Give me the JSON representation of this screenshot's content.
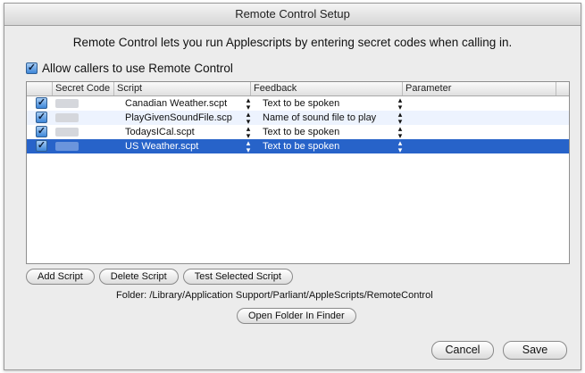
{
  "window": {
    "title": "Remote Control Setup"
  },
  "intro_text": "Remote Control lets you run Applescripts by entering secret codes when calling in.",
  "allow_checkbox": {
    "label": "Allow callers to use Remote Control",
    "checked": true
  },
  "table": {
    "columns": [
      "Secret Code",
      "Script",
      "Feedback",
      "Parameter"
    ],
    "rows": [
      {
        "enabled": true,
        "script": "Canadian Weather.scpt",
        "feedback": "Text to be spoken",
        "parameter": "",
        "selected": false
      },
      {
        "enabled": true,
        "script": "PlayGivenSoundFile.scp",
        "feedback": "Name of sound file to play",
        "parameter": "",
        "selected": false
      },
      {
        "enabled": true,
        "script": "TodaysICal.scpt",
        "feedback": "Text to be spoken",
        "parameter": "",
        "selected": false
      },
      {
        "enabled": true,
        "script": "US Weather.scpt",
        "feedback": "Text to be spoken",
        "parameter": "",
        "selected": true
      }
    ]
  },
  "buttons": {
    "add_script": "Add Script",
    "delete_script": "Delete Script",
    "test_selected": "Test Selected Script",
    "open_folder": "Open Folder In Finder",
    "cancel": "Cancel",
    "save": "Save"
  },
  "folder": {
    "label": "Folder:",
    "path": "/Library/Application Support/Parliant/AppleScripts/RemoteControl"
  },
  "icons": {
    "checkbox": "checkbox-checked-icon",
    "stepper": "popup-stepper-icon"
  },
  "colors": {
    "selection": "#2763c9",
    "alt_row": "#edf3fe",
    "checkbox": "#3d86d8"
  }
}
